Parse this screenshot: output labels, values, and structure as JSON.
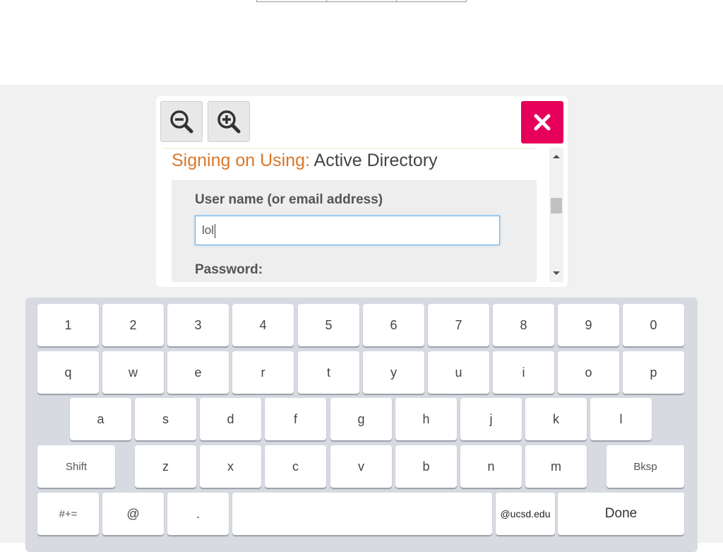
{
  "dialog": {
    "zoom_out_icon": "zoom-out-icon",
    "zoom_in_icon": "zoom-in-icon",
    "close_icon": "close-icon",
    "signing_label": "Signing on Using:",
    "signing_value": "Active Directory",
    "username_label": "User name (or email address)",
    "username_value": "lol",
    "password_label": "Password:"
  },
  "colors": {
    "close_button": "#e6005c",
    "signing_label": "#d9772b",
    "input_focus": "#66afe9",
    "keyboard_bg": "#d7dae1"
  },
  "keyboard": {
    "row1": [
      "1",
      "2",
      "3",
      "4",
      "5",
      "6",
      "7",
      "8",
      "9",
      "0"
    ],
    "row2": [
      "q",
      "w",
      "e",
      "r",
      "t",
      "y",
      "u",
      "i",
      "o",
      "p"
    ],
    "row3": [
      "a",
      "s",
      "d",
      "f",
      "g",
      "h",
      "j",
      "k",
      "l"
    ],
    "row4_letters": [
      "z",
      "x",
      "c",
      "v",
      "b",
      "n",
      "m"
    ],
    "shift": "Shift",
    "backspace": "Bksp",
    "symbols": "#+=",
    "at": "@",
    "dot": ".",
    "space": "",
    "domain": "@ucsd.edu",
    "done": "Done"
  }
}
